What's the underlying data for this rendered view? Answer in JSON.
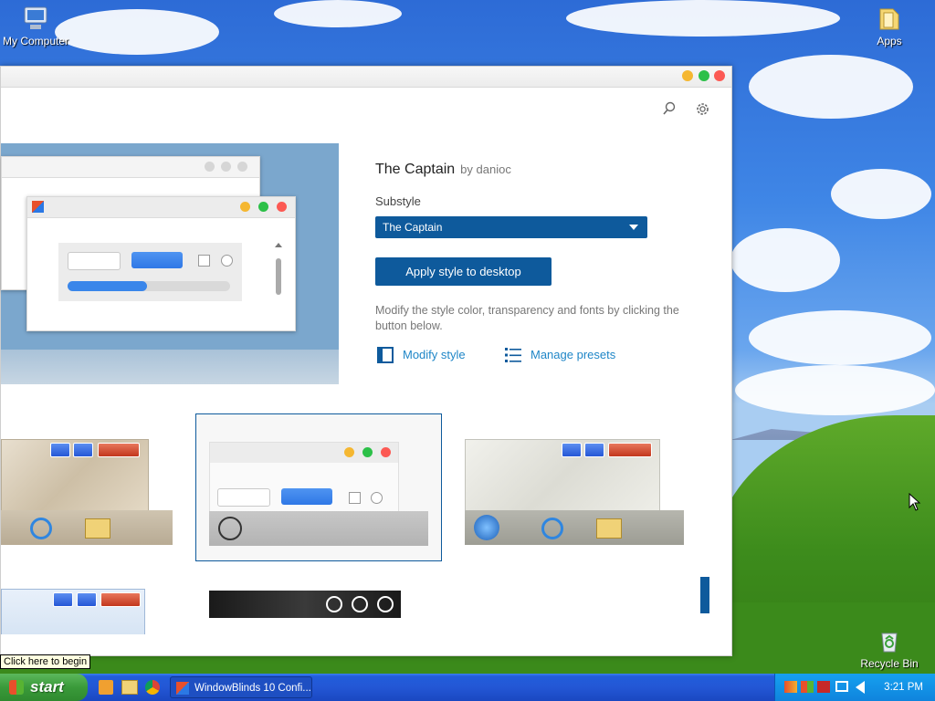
{
  "desktop": {
    "icons": [
      {
        "label": "My Computer",
        "icon": "computer-icon"
      },
      {
        "label": "Apps",
        "icon": "folder-icon"
      },
      {
        "label": "Recycle Bin",
        "icon": "recycle-bin-icon"
      }
    ],
    "cursor_icon": "mouse-pointer-icon"
  },
  "window": {
    "toolbar_icons": [
      "search-icon",
      "gear-icon"
    ],
    "controls_colors": {
      "minimize": "#f5b731",
      "maximize": "#2cc048",
      "close": "#fc5953"
    },
    "accent": "#0e5a9c",
    "link_color": "#1f86c7"
  },
  "details": {
    "title": "The Captain",
    "author": "by danioc",
    "substyle_label": "Substyle",
    "substyle_value": "The Captain",
    "apply_label": "Apply style to desktop",
    "description": "Modify the style color, transparency and fonts by clicking the button below.",
    "modify_label": "Modify style",
    "presets_label": "Manage presets"
  },
  "taskbar": {
    "start_label": "start",
    "tooltip": "Click here to begin",
    "active_task": "WindowBlinds 10 Confi...",
    "clock": "3:21 PM",
    "quick_launch_icons": [
      "media-player-icon",
      "folder-icon",
      "chrome-icon"
    ],
    "tray_icons": [
      "network-icon",
      "windows-flag-icon",
      "security-alert-icon",
      "display-icon",
      "volume-icon"
    ]
  }
}
